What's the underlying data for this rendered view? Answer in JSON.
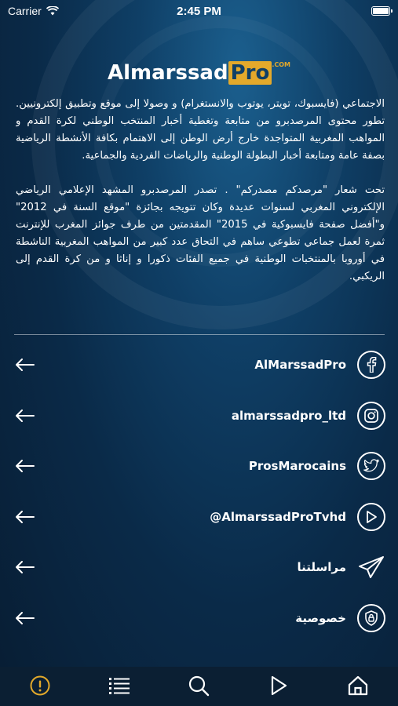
{
  "status": {
    "carrier": "Carrier",
    "time": "2:45 PM"
  },
  "logo": {
    "part1": "Almarssad",
    "part2": "Pro",
    "part3": ".COM"
  },
  "about": {
    "paragraph1": "الاجتماعي (فايسبوك، تويتر، يوتوب والانستغرام) و وصولا إلى موقع وتطبيق إلكترونيين. تطور محتوى المرصدبرو من متابعة وتغطية أخبار المنتخب الوطني لكرة القدم و المواهب المغربية المتواجدة خارج أرض الوطن إلى الاهتمام بكافة الأنشطة الرياضية بصفة عامة ومتابعة أخبار البطولة الوطنية والرياضات الفردية والجماعية.",
    "paragraph2": "تحت شعار \"مرصدكم مصدركم\" . تصدر المرصدبرو المشهد الإعلامي الرياضي الإلكتروني المغربي لسنوات عديدة وكان تتويجه بجائزة \"موقع السنة في 2012\" و\"أفضل صفحة فايسبوكية في 2015\" المقدمتين من طرف جوائز المغرب للإنترنت ثمرة لعمل جماعي تطوعي ساهم في التحاق عدد كبير من المواهب المغربية الناشطة في أوروبا بالمنتخبات الوطنية في جميع الفئات ذكورا و إناثا و من كرة القدم إلى الريكبي."
  },
  "links": [
    {
      "label": "AlMarssadPro",
      "icon": "facebook-icon"
    },
    {
      "label": "almarssadpro_ltd",
      "icon": "instagram-icon"
    },
    {
      "label": "ProsMarocains",
      "icon": "twitter-icon"
    },
    {
      "label": "@AlmarssadProTvhd",
      "icon": "play-icon"
    },
    {
      "label": "مراسلتنا",
      "icon": "send-icon"
    },
    {
      "label": "خصوصية",
      "icon": "privacy-shield-icon"
    }
  ],
  "tabs": [
    {
      "name": "info",
      "icon": "info-icon",
      "active": true
    },
    {
      "name": "list",
      "icon": "list-icon"
    },
    {
      "name": "search",
      "icon": "search-icon"
    },
    {
      "name": "video",
      "icon": "play-icon"
    },
    {
      "name": "home",
      "icon": "home-icon"
    }
  ],
  "colors": {
    "accent": "#e3a92b",
    "tabbar_bg": "#0b1f33",
    "page_bg": "#0f3f66"
  }
}
